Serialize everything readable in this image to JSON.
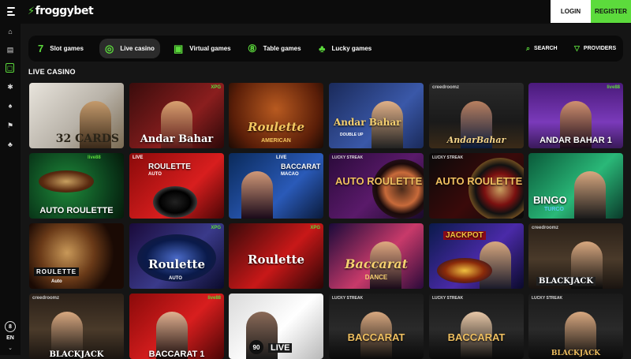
{
  "header": {
    "logo_text": "froggybet",
    "login_label": "LOGIN",
    "register_label": "REGISTER"
  },
  "sidebar": {
    "icons": [
      "home-icon",
      "slot-icon",
      "casino-icon",
      "settings-icon",
      "cards-icon",
      "flag-icon",
      "bell-icon"
    ],
    "language": "EN"
  },
  "nav": {
    "items": [
      {
        "label": "Slot games",
        "icon": "7"
      },
      {
        "label": "Live casino",
        "icon": "◎"
      },
      {
        "label": "Virtual games",
        "icon": "▣"
      },
      {
        "label": "Table games",
        "icon": "⑧"
      },
      {
        "label": "Lucky games",
        "icon": "♣"
      }
    ],
    "search_label": "SEARCH",
    "providers_label": "PROVIDERS"
  },
  "section": {
    "title": "LIVE CASINO"
  },
  "games": [
    {
      "title": "32 CARDS",
      "provider": ""
    },
    {
      "title": "Andar Bahar",
      "provider": "XPG"
    },
    {
      "title": "Roulette",
      "subtitle": "AMERICAN",
      "provider": ""
    },
    {
      "title": "Andar Bahar",
      "subtitle": "DOUBLE UP",
      "provider": ""
    },
    {
      "title": "AndarBahar",
      "provider": "creedroomz"
    },
    {
      "title": "ANDAR BAHAR 1",
      "provider": "live88"
    },
    {
      "title": "AUTO ROULETTE",
      "provider": "live88"
    },
    {
      "title": "ROULETTE",
      "subtitle": "AUTO",
      "provider": "LIVE"
    },
    {
      "title": "BACCARAT",
      "subtitle": "MACAO",
      "provider": "LIVE"
    },
    {
      "title": "AUTO ROULETTE",
      "provider": "LUCKY STREAK"
    },
    {
      "title": "AUTO ROULETTE",
      "provider": "LUCKY STREAK"
    },
    {
      "title": "BINGO",
      "subtitle": "TURCO",
      "provider": ""
    },
    {
      "title": "ROULETTE",
      "subtitle": "Auto",
      "provider": ""
    },
    {
      "title": "Roulette",
      "subtitle": "AUTO",
      "provider": "XPG"
    },
    {
      "title": "Roulette",
      "provider": "XPG"
    },
    {
      "title": "Baccarat",
      "subtitle": "DANCE",
      "provider": ""
    },
    {
      "title": "JACKPOT",
      "provider": ""
    },
    {
      "title": "BLACKJACK",
      "provider": "creedroomz"
    },
    {
      "title": "BLACKJACK",
      "provider": "creedroomz"
    },
    {
      "title": "BACCARAT 1",
      "provider": "live88"
    },
    {
      "title": "BINGO",
      "subtitle": "90",
      "provider": "LIVE"
    },
    {
      "title": "BACCARAT",
      "provider": "LUCKY STREAK"
    },
    {
      "title": "BACCARAT",
      "provider": "LUCKY STREAK"
    },
    {
      "title": "BLACKJACK",
      "provider": "LUCKY STREAK"
    }
  ]
}
